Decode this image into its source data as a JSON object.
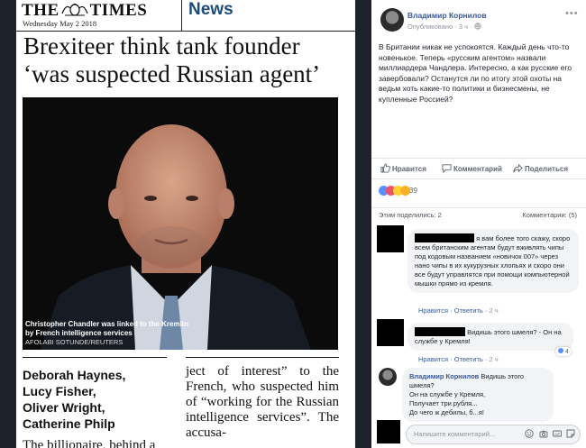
{
  "newspaper": {
    "name": "THE TIMES",
    "name_left": "THE",
    "name_right": "TIMES",
    "date": "Wednesday May 2 2018",
    "section": "News",
    "headline_line1": "Brexiteer think tank founder",
    "headline_line2": "‘was suspected Russian agent’",
    "caption": "Christopher Chandler was linked to the Kremlin by French intelligence services",
    "credit": "AFOLABI SOTUNDE/REUTERS",
    "bylines": [
      "Deborah Haynes,",
      "Lucy Fisher,",
      "Oliver Wright,",
      "Catherine Philp"
    ],
    "body_text": "ject of interest” to the French, who suspected him of “working for the Russian intelligence services”. The accusa-",
    "body_last": "The billionaire, behind a"
  },
  "post": {
    "author": "Владимир Корнилов",
    "meta": "Опубликовано · 3 ч ·",
    "menu_glyph": "•••",
    "text": "В Британии никак не успокоятся. Каждый день что-то новенькое. Теперь «русским агентом» назвали миллиардера Чандлера. Интересно, а как русские его завербовали? Останутся ли по итогу этой охоты на ведьм хоть какие-то политики и бизнесмены, не купленные Россией?",
    "like_label": "Нравится",
    "comment_label": "Комментарий",
    "share_label": "Поделиться",
    "reactions_count": "39",
    "shares": "Этим поделились: 2",
    "comments_count": "Комментарии: (5)"
  },
  "comments": [
    {
      "text": "я вам более того скажу, скоро всем британским агентам будут вживлять чипы под кодовым названием «новичок 007» через нано чипы в их кукурузных хлопьях и скоро они все будут управлятся при помощи компьютерной мышки прямо из кремля.",
      "like": "Нравится",
      "reply": "Ответить",
      "time": "2 ч"
    },
    {
      "text": "Видишь этого шмеля? - Он на службе у Кремля!",
      "like": "Нравится",
      "reply": "Ответить",
      "time": "2 ч",
      "reaction_count": "4"
    },
    {
      "author": "Владимир Корнилов",
      "text_first": "Видишь этого шмеля?",
      "text_rest": "Он на службе у Кремля,\nПолучает три рубля...\nДо чего ж дебилы, б...я!"
    }
  ],
  "comment_input": {
    "placeholder": "Напишите комментарий..."
  },
  "colors": {
    "page_bg": "#1d2129",
    "fb_link": "#365899",
    "times_section": "#1c4a7a",
    "like_blue": "#5890ff",
    "love_red": "#f25268",
    "haha_yellow": "#fdd233"
  }
}
